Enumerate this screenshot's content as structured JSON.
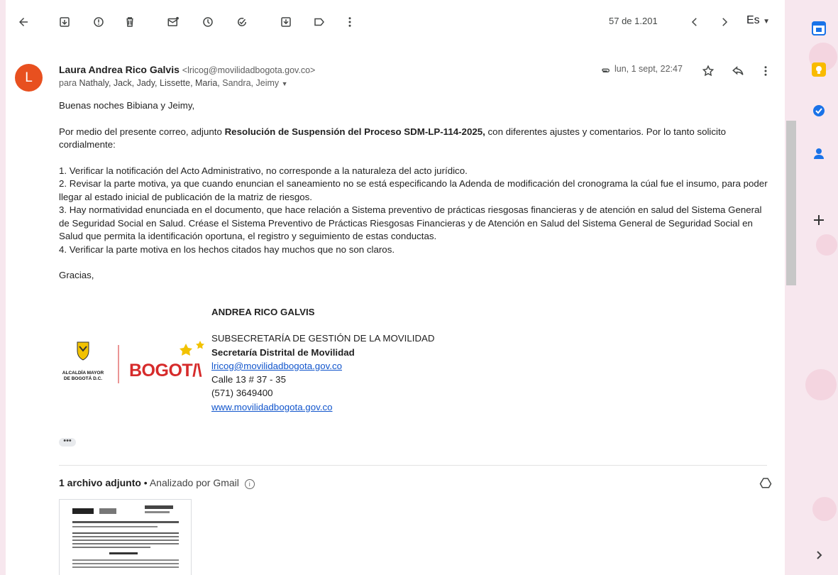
{
  "toolbar": {
    "pager_text": "57 de 1.201",
    "lang_label": "Es"
  },
  "message": {
    "avatar_letter": "L",
    "sender_name": "Laura Andrea Rico Galvis",
    "sender_email": "<lricog@movilidadbogota.gov.co>",
    "recipients_prefix": "para",
    "recipients_bold": "Nathaly, Jack, Jady, Lissette, Maria,",
    "recipients_rest": "Sandra, Jeimy",
    "date": "lun, 1 sept, 22:47",
    "greeting": "Buenas noches Bibiana y Jeimy,",
    "intro_before": "Por medio del presente correo, adjunto ",
    "intro_bold": "Resolución de Suspensión del Proceso SDM-LP-114-2025,",
    "intro_after": " con diferentes ajustes y comentarios. Por lo tanto solicito cordialmente:",
    "items": [
      "1. Verificar la notificación del Acto Administrativo, no corresponde a la naturaleza del acto jurídico.",
      "2. Revisar la parte motiva, ya que cuando enuncian el saneamiento no se está especificando la Adenda de modificación del cronograma la cúal fue el insumo, para poder llegar al estado inicial de publicación de la matriz de riesgos.",
      "3. Hay normatividad enunciada en el documento, que hace relación a Sistema preventivo de prácticas riesgosas financieras y de atención en salud del Sistema General de Seguridad Social en Salud. Créase el Sistema Preventivo de Prácticas Riesgosas Financieras y de Atención en Salud del Sistema General de Seguridad Social en Salud que permita la identificación oportuna, el registro y seguimiento de estas conductas.",
      "4. Verificar la parte motiva en los hechos citados hay muchos que no son claros."
    ],
    "closing": "Gracias,"
  },
  "signature": {
    "name": "ANDREA RICO GALVIS",
    "dept": "SUBSECRETARÍA DE GESTIÓN DE LA MOVILIDAD",
    "org": "Secretaría Distrital de Movilidad",
    "email": "lricog@movilidadbogota.gov.co",
    "address": "Calle 13 # 37 - 35",
    "phone": "(571) 3649400",
    "website": "www.movilidadbogota.gov.co",
    "logo_left_text_1": "ALCALDÍA MAYOR",
    "logo_left_text_2": "DE BOGOTÁ D.C.",
    "logo_brand": "BOGOT/\\"
  },
  "ellipsis": "•••",
  "attachments": {
    "title": "1 archivo adjunto",
    "separator": " • ",
    "subtitle": "Analizado por Gmail"
  }
}
